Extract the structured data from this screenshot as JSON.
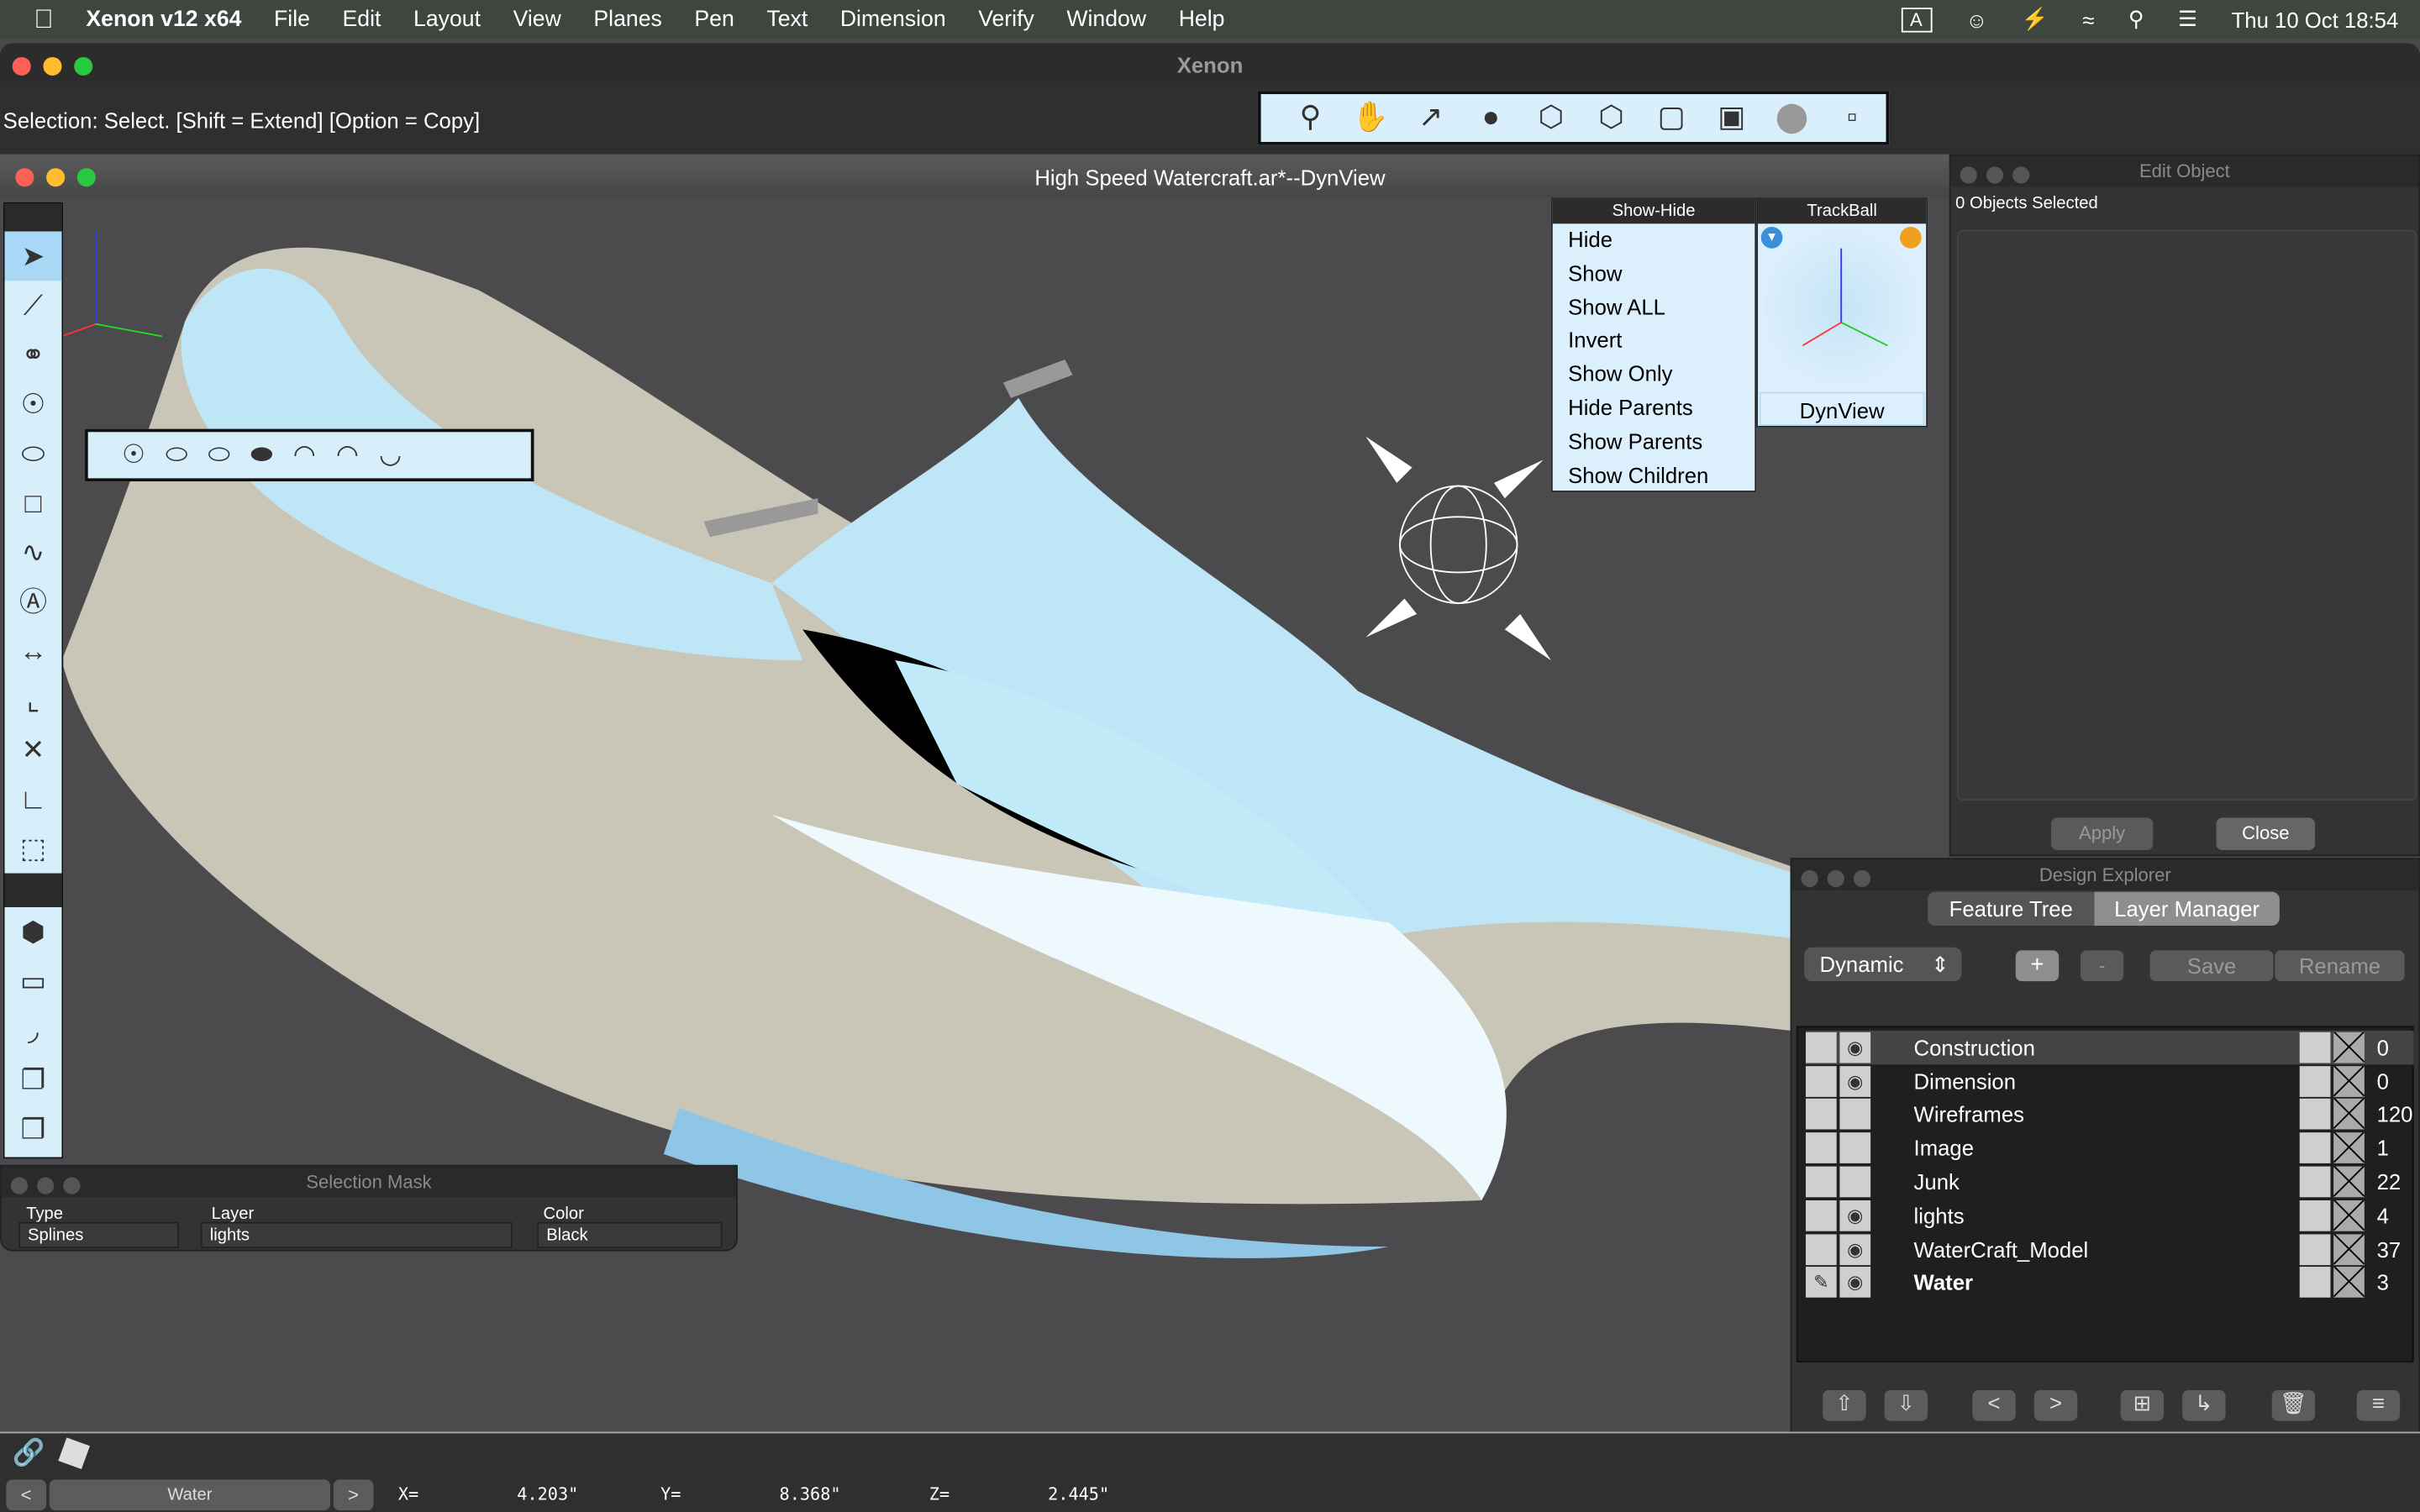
{
  "menubar": {
    "app": "Xenon v12 x64",
    "items": [
      "File",
      "Edit",
      "Layout",
      "View",
      "Planes",
      "Pen",
      "Text",
      "Dimension",
      "Verify",
      "Window",
      "Help"
    ],
    "input_indicator": "A",
    "datetime": "Thu 10 Oct  18:54"
  },
  "window": {
    "title": "Xenon",
    "status_text": "Selection: Select. [Shift = Extend] [Option = Copy]"
  },
  "document": {
    "title": "High Speed Watercraft.ar*--DynView"
  },
  "toolbar": {
    "icons": [
      "zoom-icon",
      "pan-hand-icon",
      "scale-icon",
      "render-shade-icon",
      "wireframe-cube-icon",
      "hidden-line-cube-icon",
      "outline-cube-icon",
      "shaded-cube-icon",
      "sphere-icon",
      "box-view-icon"
    ]
  },
  "show_hide": {
    "title": "Show-Hide",
    "items": [
      "Hide",
      "Show",
      "Show ALL",
      "Invert",
      "Show Only",
      "Hide Parents",
      "Show Parents",
      "Show Children"
    ]
  },
  "trackball": {
    "title": "TrackBall",
    "button": "DynView"
  },
  "edit_object": {
    "title": "Edit Object",
    "status": "0 Objects Selected",
    "apply": "Apply",
    "close": "Close"
  },
  "design_explorer": {
    "title": "Design Explorer",
    "tabs": [
      "Feature Tree",
      "Layer Manager"
    ],
    "active_tab": "Layer Manager",
    "mode": "Dynamic",
    "add": "+",
    "remove": "-",
    "save": "Save",
    "rename": "Rename",
    "layers": [
      {
        "name": "Construction",
        "visible": true,
        "count": "0"
      },
      {
        "name": "Dimension",
        "visible": true,
        "count": "0"
      },
      {
        "name": "Wireframes",
        "visible": false,
        "count": "120"
      },
      {
        "name": "Image",
        "visible": false,
        "count": "1"
      },
      {
        "name": "Junk",
        "visible": false,
        "count": "22"
      },
      {
        "name": "lights",
        "visible": true,
        "count": "4"
      },
      {
        "name": "WaterCraft_Model",
        "visible": true,
        "count": "37"
      },
      {
        "name": "Water",
        "visible": true,
        "count": "3",
        "current": true
      }
    ]
  },
  "selection_mask": {
    "title": "Selection Mask",
    "type_label": "Type",
    "type_value": "Splines",
    "layer_label": "Layer",
    "layer_value": "lights",
    "color_label": "Color",
    "color_value": "Black"
  },
  "bottom": {
    "layer": "Water",
    "prev": "<",
    "next": ">",
    "x_label": "X=",
    "x": "4.203\"",
    "y_label": "Y=",
    "y": "8.368\"",
    "z_label": "Z=",
    "z": "2.445\""
  }
}
